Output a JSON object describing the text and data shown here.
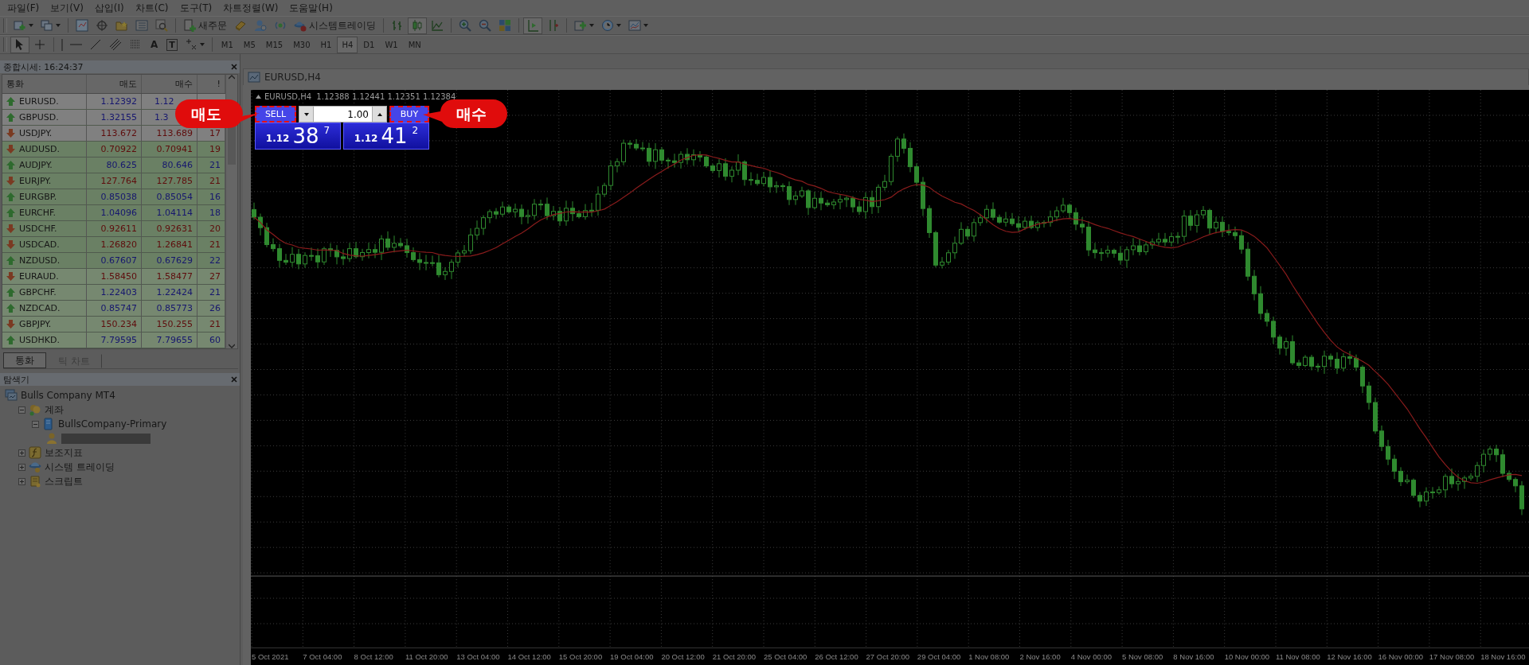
{
  "menu": [
    "파일(F)",
    "보기(V)",
    "삽입(I)",
    "차트(C)",
    "도구(T)",
    "차트정렬(W)",
    "도움말(H)"
  ],
  "toolbar": {
    "new_order": "새주문",
    "system_trading": "시스템트레이딩"
  },
  "drawing_tools": {
    "text_tool": "A",
    "label_tool": "T"
  },
  "timeframes": [
    {
      "label": "M1",
      "selected": false
    },
    {
      "label": "M5",
      "selected": false
    },
    {
      "label": "M15",
      "selected": false
    },
    {
      "label": "M30",
      "selected": false
    },
    {
      "label": "H1",
      "selected": false
    },
    {
      "label": "H4",
      "selected": true
    },
    {
      "label": "D1",
      "selected": false
    },
    {
      "label": "W1",
      "selected": false
    },
    {
      "label": "MN",
      "selected": false
    }
  ],
  "market_watch": {
    "title": "종합시세: 16:24:37",
    "columns": [
      "통화",
      "매도",
      "매수",
      "!"
    ],
    "rows": [
      {
        "symbol": "EURUSD.",
        "bid": "1.12392",
        "ask": "1.12",
        "rising": true,
        "kind": "plain",
        "covered": true
      },
      {
        "symbol": "GBPUSD.",
        "bid": "1.32155",
        "ask": "1.3",
        "rising": true,
        "kind": "plain",
        "covered": true
      },
      {
        "symbol": "USDJPY.",
        "bid": "113.672",
        "ask": "113.689",
        "spread": "17",
        "rising": false,
        "kind": "plain",
        "covered": false
      },
      {
        "symbol": "AUDUSD.",
        "bid": "0.70922",
        "ask": "0.70941",
        "spread": "19",
        "rising": false,
        "kind": "strong",
        "covered": false
      },
      {
        "symbol": "AUDJPY.",
        "bid": "80.625",
        "ask": "80.646",
        "spread": "21",
        "rising": true,
        "kind": "strong",
        "covered": false
      },
      {
        "symbol": "EURJPY.",
        "bid": "127.764",
        "ask": "127.785",
        "spread": "21",
        "rising": false,
        "kind": "strong",
        "covered": false
      },
      {
        "symbol": "EURGBP.",
        "bid": "0.85038",
        "ask": "0.85054",
        "spread": "16",
        "rising": true,
        "kind": "strong",
        "covered": false
      },
      {
        "symbol": "EURCHF.",
        "bid": "1.04096",
        "ask": "1.04114",
        "spread": "18",
        "rising": true,
        "kind": "strong",
        "covered": false
      },
      {
        "symbol": "USDCHF.",
        "bid": "0.92611",
        "ask": "0.92631",
        "spread": "20",
        "rising": false,
        "kind": "strong",
        "covered": false
      },
      {
        "symbol": "USDCAD.",
        "bid": "1.26820",
        "ask": "1.26841",
        "spread": "21",
        "rising": false,
        "kind": "strong",
        "covered": false
      },
      {
        "symbol": "NZDUSD.",
        "bid": "0.67607",
        "ask": "0.67629",
        "spread": "22",
        "rising": true,
        "kind": "strong",
        "covered": false
      },
      {
        "symbol": "EURAUD.",
        "bid": "1.58450",
        "ask": "1.58477",
        "spread": "27",
        "rising": false,
        "kind": "light",
        "covered": false
      },
      {
        "symbol": "GBPCHF.",
        "bid": "1.22403",
        "ask": "1.22424",
        "spread": "21",
        "rising": true,
        "kind": "light",
        "covered": false
      },
      {
        "symbol": "NZDCAD.",
        "bid": "0.85747",
        "ask": "0.85773",
        "spread": "26",
        "rising": true,
        "kind": "light",
        "covered": false
      },
      {
        "symbol": "GBPJPY.",
        "bid": "150.234",
        "ask": "150.255",
        "spread": "21",
        "rising": false,
        "kind": "light",
        "covered": false
      },
      {
        "symbol": "USDHKD.",
        "bid": "7.79595",
        "ask": "7.79655",
        "spread": "60",
        "rising": true,
        "kind": "light",
        "covered": false
      }
    ],
    "tabs": [
      {
        "label": "통화",
        "selected": true
      },
      {
        "label": "틱 차트",
        "selected": false
      }
    ]
  },
  "navigator": {
    "title": "탐색기",
    "tree": [
      {
        "label": "Bulls Company MT4",
        "kind": "terminal",
        "children": [
          {
            "label": "계좌",
            "kind": "accounts",
            "expanded": true,
            "children": [
              {
                "label": "BullsCompany-Primary",
                "kind": "server",
                "expanded": true,
                "children": [
                  {
                    "kind": "account"
                  }
                ]
              }
            ]
          },
          {
            "label": "보조지표",
            "kind": "indicators",
            "expanded": false
          },
          {
            "label": "시스템 트레이딩",
            "kind": "experts",
            "expanded": false
          },
          {
            "label": "스크립트",
            "kind": "scripts",
            "expanded": false
          }
        ]
      }
    ]
  },
  "chart": {
    "title": "EURUSD,H4",
    "info": "EURUSD,H4  1.12388 1.12441 1.12351 1.12384",
    "trade": {
      "sell": {
        "label": "SELL",
        "annotated": true
      },
      "lot": "1.00",
      "buy": {
        "label": "BUY",
        "annotated": true
      },
      "bid_price": {
        "prefix": "1.12",
        "big": "38",
        "pip": "7"
      },
      "ask_price": {
        "prefix": "1.12",
        "big": "41",
        "pip": "2"
      }
    },
    "x_labels": [
      "5 Oct 2021",
      "7 Oct 04:00",
      "8 Oct 12:00",
      "11 Oct 20:00",
      "13 Oct 04:00",
      "14 Oct 12:00",
      "15 Oct 20:00",
      "19 Oct 04:00",
      "20 Oct 12:00",
      "21 Oct 20:00",
      "25 Oct 04:00",
      "26 Oct 12:00",
      "27 Oct 20:00",
      "29 Oct 04:00",
      "1 Nov 08:00",
      "2 Nov 16:00",
      "4 Nov 00:00",
      "5 Nov 08:00",
      "8 Nov 16:00",
      "10 Nov 00:00",
      "11 Nov 08:00",
      "12 Nov 16:00",
      "16 Nov 00:00",
      "17 Nov 08:00",
      "18 Nov 16:00"
    ]
  },
  "callouts": [
    {
      "text": "매도",
      "kind": "left"
    },
    {
      "text": "매수",
      "kind": "right"
    }
  ]
}
